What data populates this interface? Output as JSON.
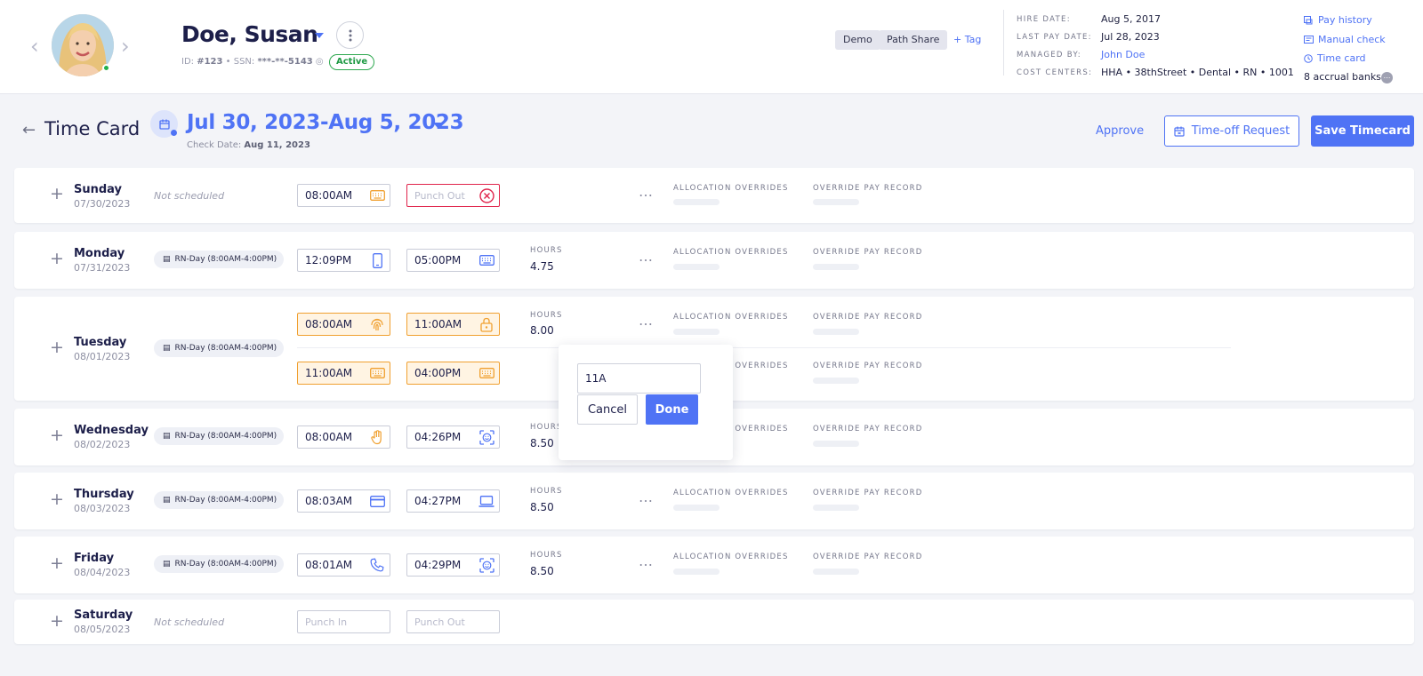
{
  "employee": {
    "name": "Doe, Susan",
    "id_label": "ID: ",
    "id_value": "#123",
    "ssn_label": " • SSN: ",
    "ssn_value": "***-**-5143",
    "status": "Active"
  },
  "tags": [
    "Demo",
    "Path Share"
  ],
  "add_tag_label": "+ Tag",
  "info": {
    "hire_date_label": "HIRE DATE:",
    "hire_date": "Aug 5, 2017",
    "last_pay_label": "LAST PAY DATE:",
    "last_pay": "Jul 28, 2023",
    "managed_by_label": "MANAGED BY:",
    "managed_by": "John Doe",
    "cost_centers_label": "COST CENTERS:",
    "cost_centers": "HHA • 38thStreet • Dental • RN • 1001"
  },
  "side_links": {
    "pay_history": "Pay history",
    "manual_check": "Manual check",
    "time_card": "Time card",
    "accrual_banks": "8 accrual banks"
  },
  "page": {
    "title": "Time Card",
    "period": "Jul 30, 2023-Aug 5, 2023",
    "check_date_label": "Check Date: ",
    "check_date": "Aug 11, 2023",
    "approve": "Approve",
    "time_off": "Time-off Request",
    "save": "Save Timecard"
  },
  "columns": {
    "hours": "HOURS",
    "allocation": "ALLOCATION OVERRIDES",
    "override_pay": "OVERRIDE PAY RECORD"
  },
  "placeholders": {
    "punch_in": "Punch In",
    "punch_out": "Punch Out",
    "not_scheduled": "Not scheduled"
  },
  "days": [
    {
      "name": "Sunday",
      "date": "07/30/2023",
      "in": "08:00AM",
      "in_icon": "keyboard-icon"
    },
    {
      "name": "Monday",
      "date": "07/31/2023",
      "shift": "RN-Day (8:00AM-4:00PM)",
      "in": "12:09PM",
      "in_icon": "mobile-icon",
      "out": "05:00PM",
      "out_icon": "keyboard-icon",
      "hours": "4.75"
    },
    {
      "name": "Tuesday",
      "date": "08/01/2023",
      "shift": "RN-Day (8:00AM-4:00PM)",
      "punches": [
        {
          "in": "08:00AM",
          "in_icon": "fingerprint-icon",
          "out": "11:00AM",
          "out_icon": "lock-icon",
          "hours": "8.00"
        },
        {
          "in": "11:00AM",
          "in_icon": "keyboard-icon",
          "out": "04:00PM",
          "out_icon": "keyboard-icon"
        }
      ]
    },
    {
      "name": "Wednesday",
      "date": "08/02/2023",
      "shift": "RN-Day (8:00AM-4:00PM)",
      "in": "08:00AM",
      "in_icon": "hand-icon",
      "out": "04:26PM",
      "out_icon": "face-scan-icon",
      "hours": "8.50"
    },
    {
      "name": "Thursday",
      "date": "08/03/2023",
      "shift": "RN-Day (8:00AM-4:00PM)",
      "in": "08:03AM",
      "in_icon": "card-icon",
      "out": "04:27PM",
      "out_icon": "laptop-icon",
      "hours": "8.50"
    },
    {
      "name": "Friday",
      "date": "08/04/2023",
      "shift": "RN-Day (8:00AM-4:00PM)",
      "in": "08:01AM",
      "in_icon": "phone-icon",
      "out": "04:29PM",
      "out_icon": "face-scan-icon",
      "hours": "8.50"
    },
    {
      "name": "Saturday",
      "date": "08/05/2023"
    }
  ],
  "popover": {
    "value": "11A",
    "cancel": "Cancel",
    "done": "Done"
  },
  "colors": {
    "accent": "#4f73f5",
    "status_active": "#1f9a44",
    "punch_edited": "#f0a030",
    "punch_error": "#e0244b"
  }
}
